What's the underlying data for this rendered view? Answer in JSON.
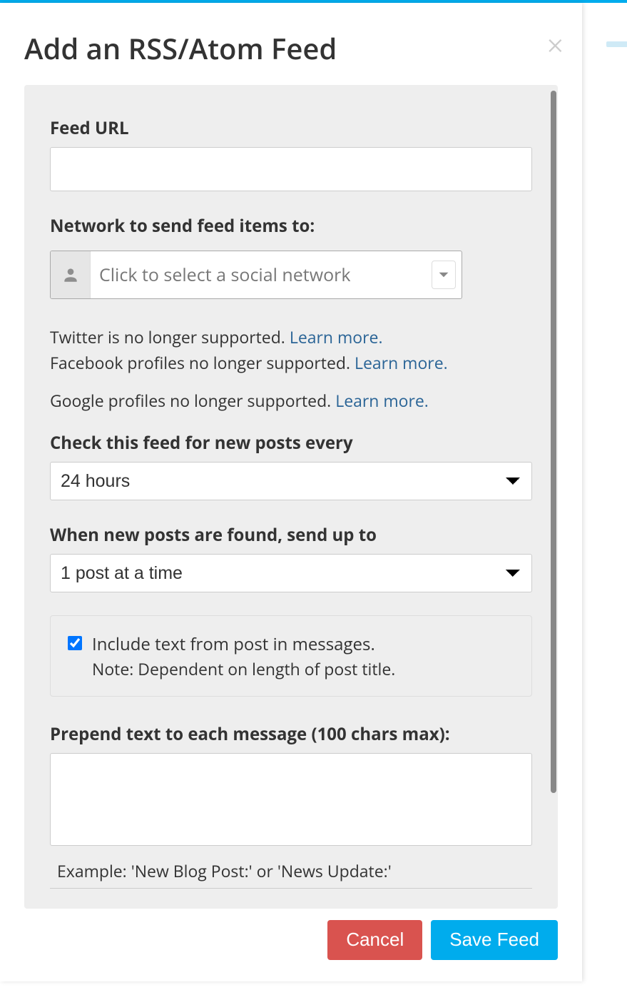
{
  "modal": {
    "title": "Add an RSS/Atom Feed"
  },
  "feed_url": {
    "label": "Feed URL",
    "value": ""
  },
  "network": {
    "label": "Network to send feed items to:",
    "placeholder": "Click to select a social network"
  },
  "notices": {
    "twitter_text": "Twitter is no longer supported. ",
    "twitter_link": "Learn more.",
    "facebook_text": "Facebook profiles no longer supported. ",
    "facebook_link": "Learn more.",
    "google_text": "Google profiles no longer supported. ",
    "google_link": "Learn more."
  },
  "check_feed": {
    "label": "Check this feed for new posts every",
    "selected": "24 hours"
  },
  "send_up_to": {
    "label": "When new posts are found, send up to",
    "selected": "1 post at a time"
  },
  "include_text": {
    "checked": true,
    "main": "Include text from post in messages.",
    "note": "Note: Dependent on length of post title."
  },
  "prepend": {
    "label": "Prepend text to each message (100 chars max):",
    "value": "",
    "example": "Example: 'New Blog Post:' or 'News Update:'"
  },
  "buttons": {
    "cancel": "Cancel",
    "save": "Save Feed"
  }
}
